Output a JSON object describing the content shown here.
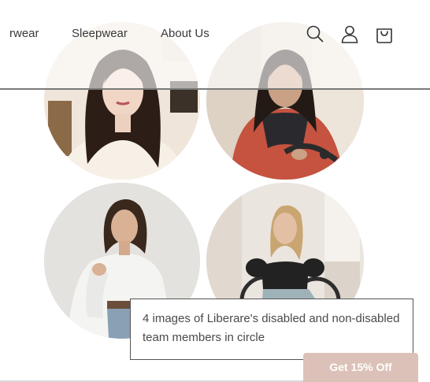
{
  "header": {
    "nav": [
      {
        "label": "rwear"
      },
      {
        "label": "Sleepwear"
      },
      {
        "label": "About Us"
      }
    ],
    "icons": [
      "search-icon",
      "account-icon",
      "cart-icon"
    ]
  },
  "tooltip": {
    "text": "4 images of Liberare's disabled and non-disabled team members in circle"
  },
  "promo": {
    "label": "Get 15% Off"
  },
  "colors": {
    "promo_bg": "#dcc1b8",
    "scarf": "#c5533f",
    "header_rule": "#7a7a7a"
  }
}
